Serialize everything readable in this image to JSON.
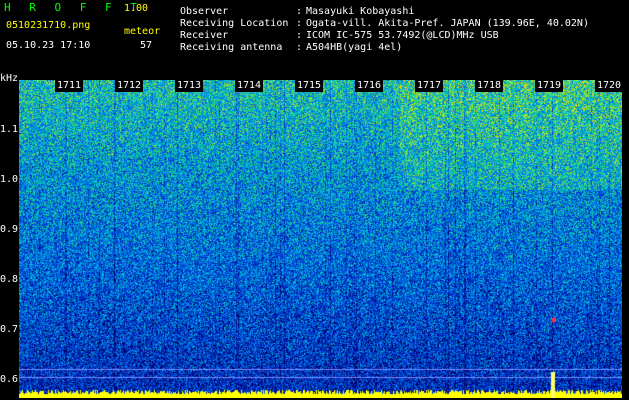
{
  "app": {
    "name": "H R O F F T",
    "version": "1.00"
  },
  "file": {
    "name": "0510231710.png",
    "datetime": "05.10.23 17:10"
  },
  "meteor": {
    "label": "meteor",
    "count": "57"
  },
  "info": [
    {
      "key": "Observer",
      "value": "Masayuki Kobayashi"
    },
    {
      "key": "Receiving Location",
      "value": "Ogata-vill. Akita-Pref. JAPAN (139.96E, 40.02N)"
    },
    {
      "key": "Receiver",
      "value": "ICOM IC-575 53.7492(@LCD)MHz USB"
    },
    {
      "key": "Receiving antenna",
      "value": "A504HB(yagi 4el)"
    }
  ],
  "axis": {
    "unit": "kHz",
    "ticks": [
      "1.1",
      "1.0",
      "0.9",
      "0.8",
      "0.7",
      "0.6"
    ],
    "time_labels": [
      "1711",
      "1712",
      "1713",
      "1714",
      "1715",
      "1716",
      "1717",
      "1718",
      "1719",
      "1720"
    ]
  },
  "colors": {
    "header_title": "#00ff00",
    "header_text": "#ffffff",
    "base_band": "#ffff00"
  }
}
